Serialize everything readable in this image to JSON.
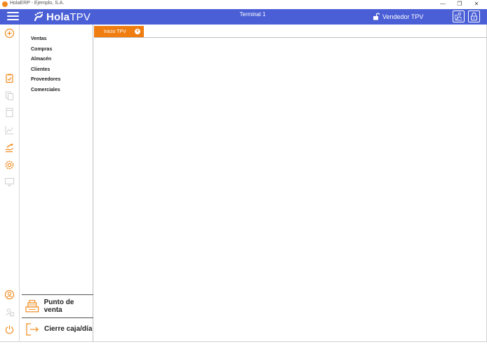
{
  "window": {
    "title": "HolaERP - Ejemplo, S.A.",
    "minimize_icon": "minimize-icon",
    "restore_icon": "restore-icon",
    "close_icon": "close-icon"
  },
  "header": {
    "brand_bold": "Hola",
    "brand_light": "TPV",
    "terminal": "Terminal 1",
    "user": "Vendedor TPV",
    "accent_color": "#4a5fd6"
  },
  "rail": {
    "icons": [
      "add-circle-icon",
      "clipboard-check-icon",
      "documents-icon",
      "document-icon",
      "chart-line-icon",
      "hand-coins-icon",
      "gear-icon",
      "monitor-icon",
      "user-circle-icon",
      "user-card-icon",
      "power-icon"
    ]
  },
  "menu": {
    "items": [
      "Ventas",
      "Compras",
      "Almacén",
      "Clientes",
      "Proveedores",
      "Comerciales"
    ]
  },
  "actions": {
    "pos_label": "Punto de venta",
    "close_label": "Cierre caja/día"
  },
  "tabs": [
    {
      "label": "Inicio TPV",
      "color": "#f07d10"
    }
  ]
}
